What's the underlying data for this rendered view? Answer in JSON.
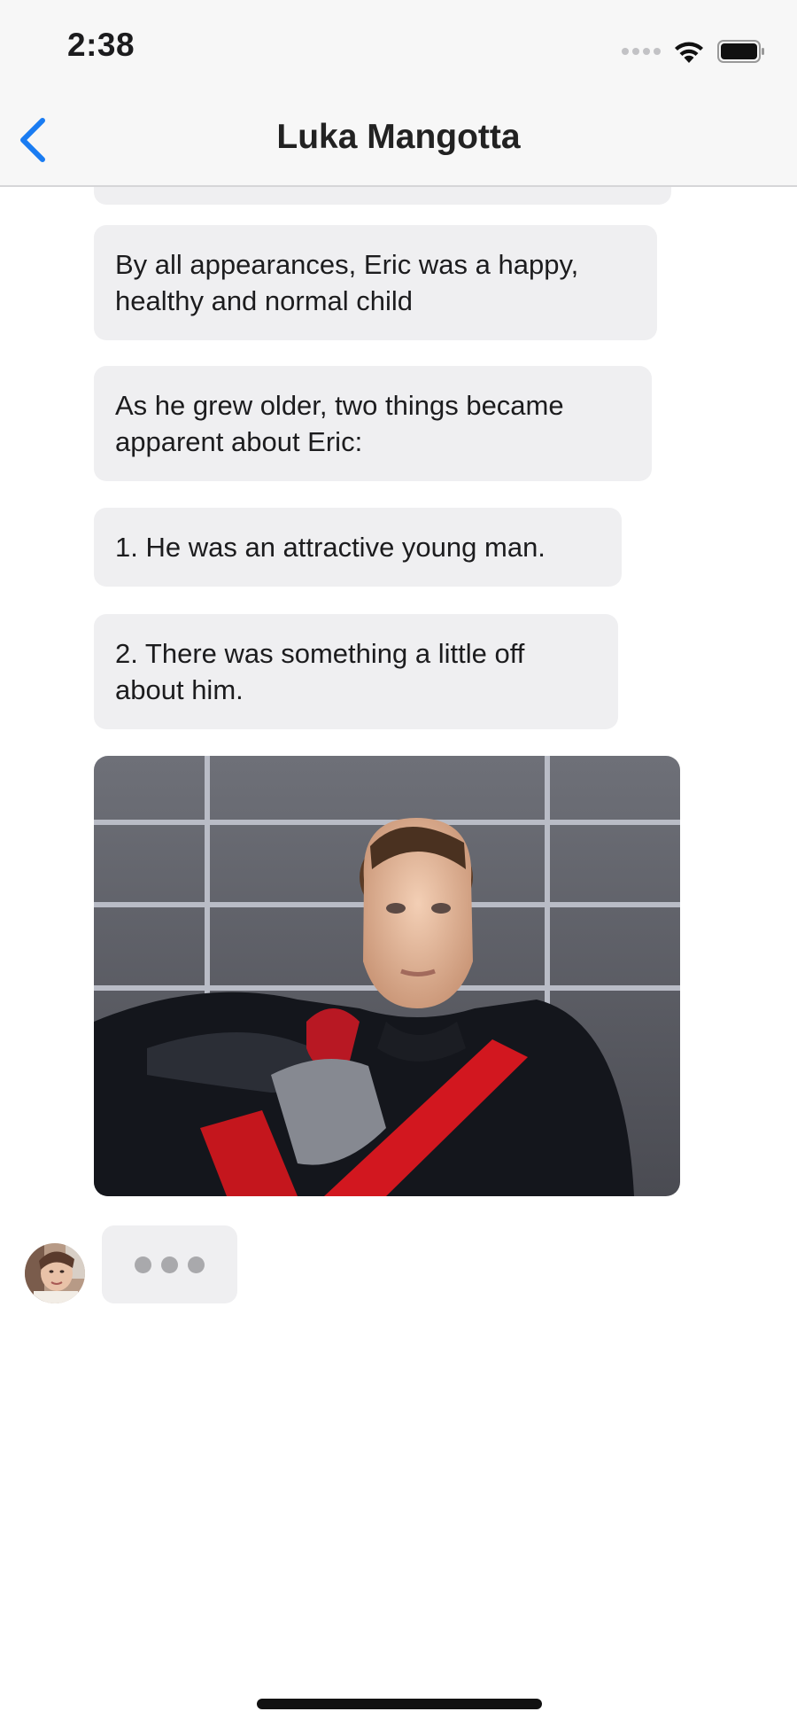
{
  "status_bar": {
    "time": "2:38"
  },
  "nav": {
    "title": "Luka Mangotta",
    "back_icon": "chevron-left-icon",
    "accent_color": "#1a7cf2"
  },
  "messages": [
    {
      "text": "By all appearances, Eric was a happy, healthy and normal child"
    },
    {
      "text": "As he grew older, two things became apparent about Eric:"
    },
    {
      "text": "1.  He was an attractive young man."
    },
    {
      "text": "2.  There was something a little off about him."
    }
  ],
  "typing_indicator": {
    "icon": "typing-dots-icon"
  }
}
